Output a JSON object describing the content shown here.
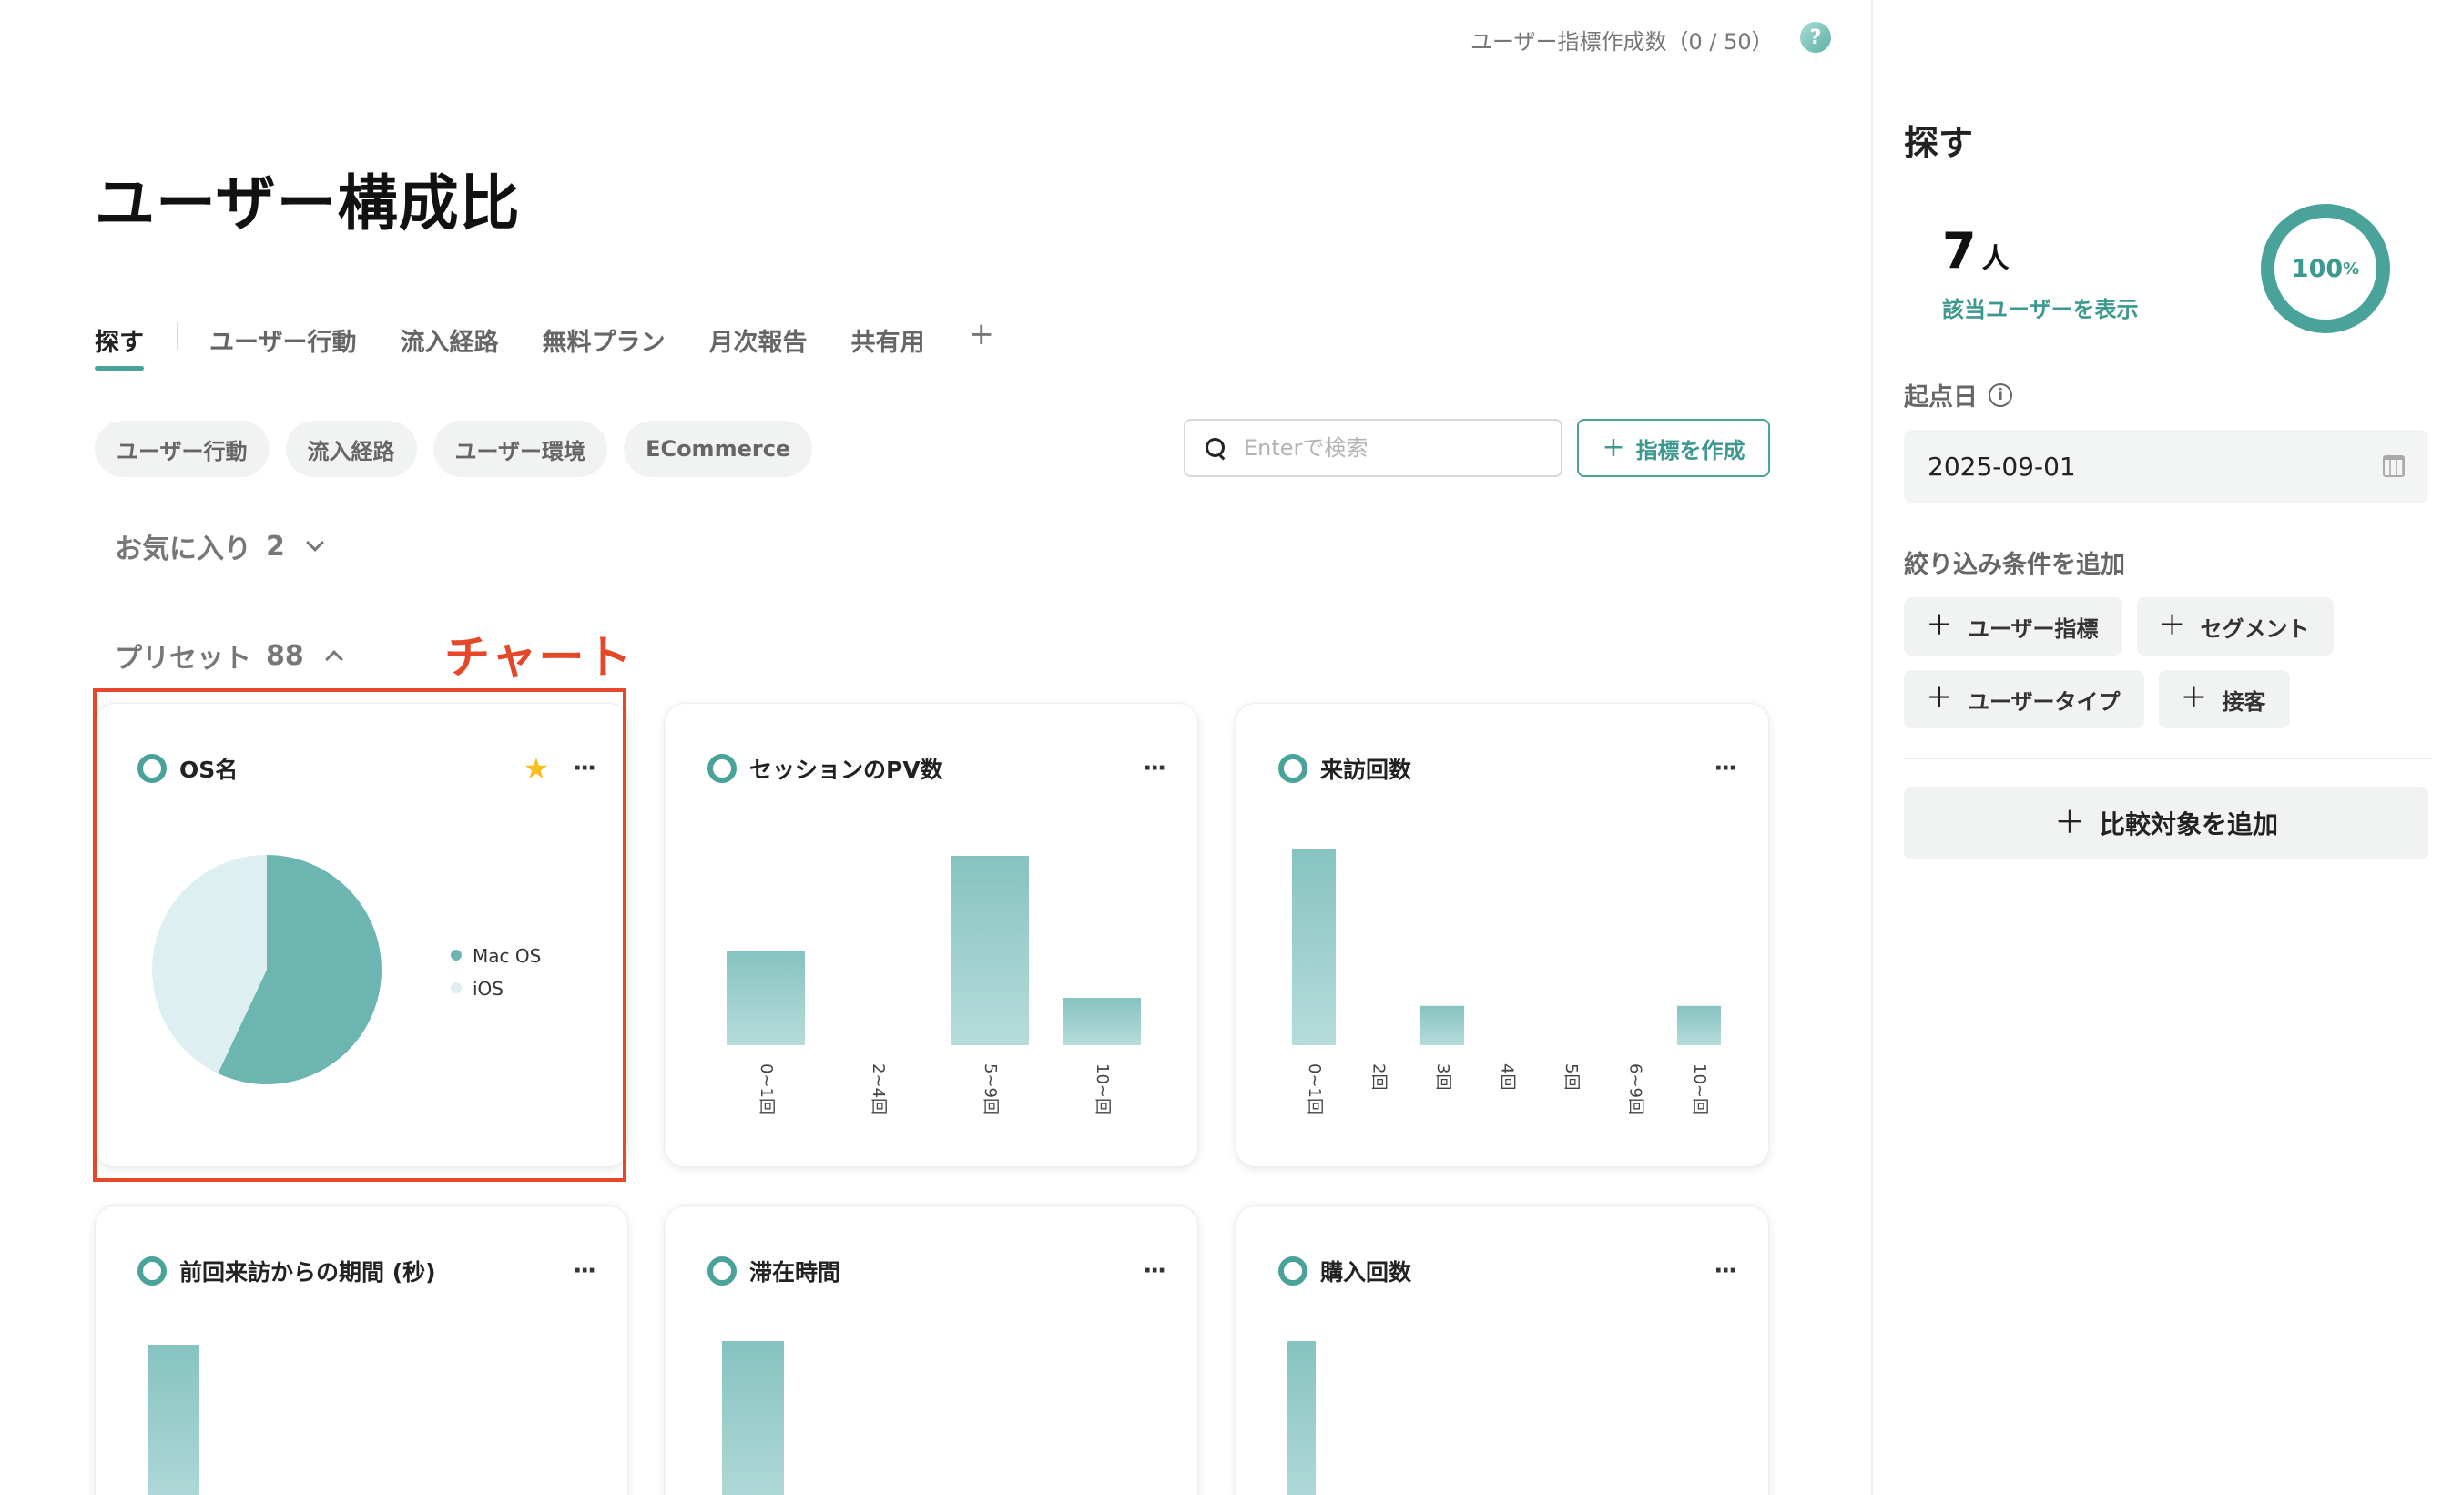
{
  "header": {
    "quota_text": "ユーザー指標作成数（0 / 50）",
    "help_icon": "?"
  },
  "page_title": "ユーザー構成比",
  "tabs": [
    {
      "label": "探す",
      "active": true
    },
    {
      "label": "ユーザー行動"
    },
    {
      "label": "流入経路"
    },
    {
      "label": "無料プラン"
    },
    {
      "label": "月次報告"
    },
    {
      "label": "共有用"
    }
  ],
  "tab_add": "+",
  "categories": [
    "ユーザー行動",
    "流入経路",
    "ユーザー環境",
    "ECommerce"
  ],
  "search": {
    "placeholder": "Enterで検索",
    "value": ""
  },
  "create_button": "指標を作成",
  "favorites": {
    "label": "お気に入り",
    "count": "2"
  },
  "presets": {
    "label": "プリセット",
    "count": "88"
  },
  "annotation": "チャート",
  "chart_data": [
    {
      "type": "pie",
      "title": "OS名",
      "starred": true,
      "labels": [
        "Mac OS",
        "iOS"
      ],
      "values": [
        57,
        43
      ],
      "colors": [
        "#6cb5b1",
        "#deeff1"
      ],
      "legend": "right"
    },
    {
      "type": "bar",
      "title": "セッションのPV数",
      "categories": [
        "0~1回",
        "2~4回",
        "5~9回",
        "10~回"
      ],
      "values": [
        2,
        0,
        4,
        1
      ],
      "ylim": [
        0,
        4
      ]
    },
    {
      "type": "bar",
      "title": "来訪回数",
      "categories": [
        "0~1回",
        "2回",
        "3回",
        "4回",
        "5回",
        "6~9回",
        "10~回"
      ],
      "values": [
        5,
        0,
        1,
        0,
        0,
        0,
        1
      ],
      "ylim": [
        0,
        5
      ]
    },
    {
      "type": "bar",
      "title": "前回来訪からの期間 (秒)",
      "categories": [],
      "values": []
    },
    {
      "type": "bar",
      "title": "滞在時間",
      "categories": [],
      "values": []
    },
    {
      "type": "bar",
      "title": "購入回数",
      "categories": [],
      "values": []
    }
  ],
  "right_panel": {
    "title": "探す",
    "count": "7",
    "unit": "人",
    "show_users_link": "該当ユーザーを表示",
    "percent": "100",
    "percent_unit": "%",
    "start_date_label": "起点日",
    "info_icon": "i",
    "start_date": "2025-09-01",
    "filter_label": "絞り込み条件を追加",
    "filter_buttons": [
      "ユーザー指標",
      "セグメント",
      "ユーザータイプ",
      "接客"
    ],
    "compare_button": "比較対象を追加",
    "plus": "＋"
  },
  "colors": {
    "accent": "#4aa39a",
    "annotation": "#e5472a",
    "bar_top": "#86c3c0",
    "bar_bottom": "#b6dcdb"
  }
}
